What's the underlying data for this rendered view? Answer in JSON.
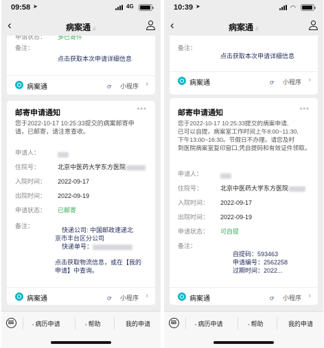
{
  "left": {
    "status": {
      "time": "09:58",
      "network": "4G"
    },
    "nav": {
      "back": "‹",
      "title": "病案通"
    },
    "top_card": {
      "status_label": "申请状态：",
      "status_value": "多已寄件",
      "remark_label": "备注：",
      "link": "点击获取本次申请详细信息",
      "app_name": "病案通",
      "mini_program": "小程序"
    },
    "main_card": {
      "title": "邮寄申请通知",
      "intro": [
        "您于2022-10-17 10:25:33提交的病案邮寄申",
        "请，已邮寄，请注意查收。"
      ],
      "fields": [
        {
          "label": "申请人：",
          "value": ""
        },
        {
          "label": "住院号：",
          "value": "北京中医药大学东方医院"
        },
        {
          "label": "入院时间：",
          "value": "2022-09-17"
        },
        {
          "label": "出院时间：",
          "value": "2022-09-19"
        },
        {
          "label": "申请状态：",
          "value": "已邮寄"
        }
      ],
      "remark_label": "备注：",
      "remark_lines": [
        "快递公司: 中国邮政速递北",
        "京市丰台区分公司",
        "快递单号："
      ],
      "link_lines": [
        "点击获取物流信息，或在【我的",
        "申请】中查询。"
      ],
      "app_name": "病案通",
      "mini_program": "小程序"
    },
    "tabbar": {
      "tab1": "病历申请",
      "tab2": "帮助",
      "tab3": "我的申请"
    }
  },
  "right": {
    "status": {
      "time": "10:39"
    },
    "nav": {
      "back": "‹",
      "title": "病案通"
    },
    "top_card": {
      "remark_label": "备注：",
      "link": "点击获取本次申请详细信息",
      "app_name": "病案通",
      "mini_program": "小程序"
    },
    "main_card": {
      "title": "邮寄申请通知",
      "intro": [
        "您于2022-10-17 10:25:33提交的病案申请,",
        "已可以自提。病案室工作时间上午8:00~11:30,",
        "下午13:00~16:30。节假日不办理。请您及时",
        "到医院病案室复印窗口,凭自提码和有效证件领取。"
      ],
      "fields": [
        {
          "label": "申请人：",
          "value": ""
        },
        {
          "label": "住院号：",
          "value": "北京中医药大学东方医院"
        },
        {
          "label": "入院时间：",
          "value": "2022-09-17"
        },
        {
          "label": "出院时间：",
          "value": "2022-09-19"
        },
        {
          "label": "申请状态：",
          "value": "可自提"
        }
      ],
      "remark_label": "备注：",
      "remark_lines": [
        "自提码：593463",
        "申请编号：2562258",
        "过期时间：2022..."
      ],
      "app_name": "病案通",
      "mini_program": "小程序"
    },
    "tabbar": {
      "tab1": "病历申请",
      "tab2": "帮助",
      "tab3": "我的申请"
    }
  },
  "colors": {
    "accent_green": "#3aa856",
    "link_navy": "#1c2a58",
    "brand_teal": "#13b7c9",
    "background": "#ededed"
  }
}
